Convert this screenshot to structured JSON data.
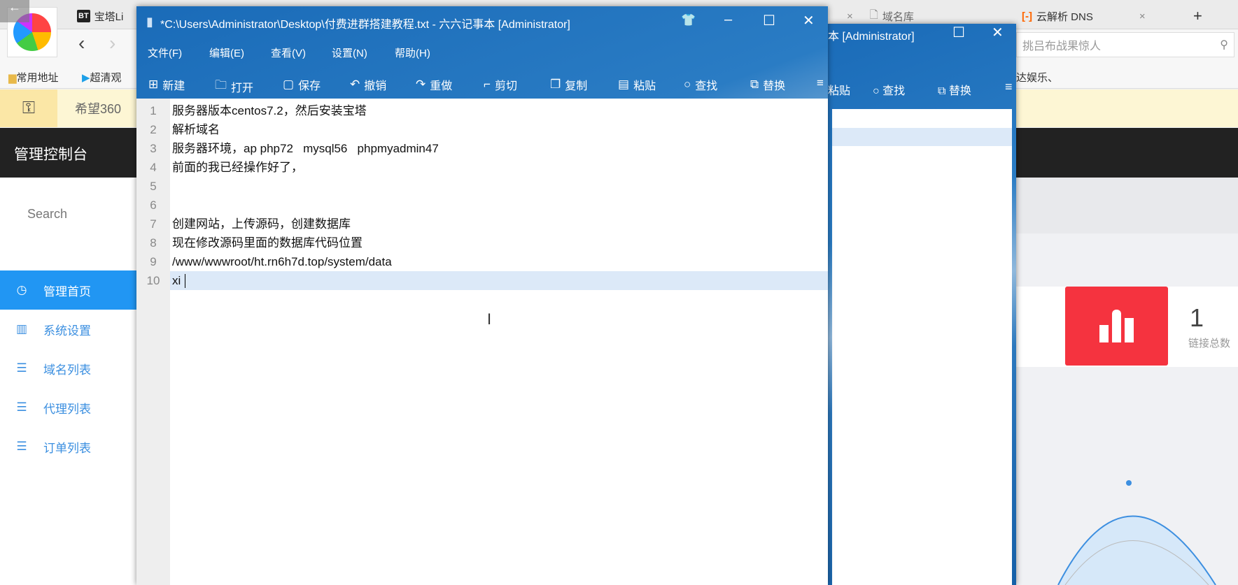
{
  "browser": {
    "tabs": [
      {
        "label": "宝塔Li",
        "icon": "bt-icon"
      },
      {
        "label": "域名库",
        "icon": "page-icon"
      },
      {
        "label": "云解析 DNS",
        "icon": "aliyun-icon"
      }
    ],
    "new_tab": "+",
    "search_placeholder": "挑吕布战果惊人",
    "bookmarks": [
      {
        "label": "常用地址"
      },
      {
        "label": "超清观"
      }
    ],
    "bookmark_right": "达娱乐、",
    "notice": "希望360"
  },
  "admin": {
    "title": "管理控制台",
    "search": "Search",
    "nav": [
      {
        "label": "管理首页",
        "icon": "dashboard-icon",
        "active": true
      },
      {
        "label": "系统设置",
        "icon": "grid-icon"
      },
      {
        "label": "域名列表",
        "icon": "list-icon"
      },
      {
        "label": "代理列表",
        "icon": "list-icon"
      },
      {
        "label": "订单列表",
        "icon": "list-icon"
      }
    ],
    "stat": {
      "value": "1",
      "label": "链接总数",
      "color": "#f5333f"
    }
  },
  "notepad": {
    "title": "*C:\\Users\\Administrator\\Desktop\\付费进群搭建教程.txt - 六六记事本 [Administrator]",
    "menu": [
      "文件(F)",
      "编辑(E)",
      "查看(V)",
      "设置(N)",
      "帮助(H)"
    ],
    "toolbar": [
      {
        "label": "新建",
        "icon": "new-icon",
        "glyph": "⊞"
      },
      {
        "label": "打开",
        "icon": "folder-icon",
        "glyph": "🗀"
      },
      {
        "label": "保存",
        "icon": "save-icon",
        "glyph": "▢"
      },
      {
        "label": "撤销",
        "icon": "undo-icon",
        "glyph": "↶"
      },
      {
        "label": "重做",
        "icon": "redo-icon",
        "glyph": "↷"
      },
      {
        "label": "剪切",
        "icon": "cut-icon",
        "glyph": "⌐"
      },
      {
        "label": "复制",
        "icon": "copy-icon",
        "glyph": "❐"
      },
      {
        "label": "粘贴",
        "icon": "paste-icon",
        "glyph": "▤"
      },
      {
        "label": "查找",
        "icon": "search-icon",
        "glyph": "○"
      },
      {
        "label": "替换",
        "icon": "replace-icon",
        "glyph": "⧉"
      },
      {
        "label": "",
        "icon": "more-icon",
        "glyph": "≡"
      }
    ],
    "lines": [
      "服务器版本centos7.2，然后安装宝塔",
      "解析域名",
      "服务器环境，ap php72   mysql56   phpmyadmin47",
      "前面的我已经操作好了，",
      "",
      "",
      "创建网站，上传源码，创建数据库",
      "现在修改源码里面的数据库代码位置",
      "/www/wwwroot/ht.rn6h7d.top/system/data",
      "xi"
    ],
    "current_line": 10
  },
  "notepad2": {
    "title": "本 [Administrator]",
    "toolbar": [
      {
        "label": "粘贴",
        "icon": "paste-icon"
      },
      {
        "label": "查找",
        "icon": "search-icon",
        "glyph": "○"
      },
      {
        "label": "替换",
        "icon": "replace-icon",
        "glyph": "⧉"
      },
      {
        "label": "",
        "icon": "more-icon",
        "glyph": "≡"
      }
    ]
  },
  "colors": {
    "accent": "#2196f3",
    "titlebar": "#1565b0",
    "header": "#222222",
    "line_highlight": "#dce9f8"
  }
}
